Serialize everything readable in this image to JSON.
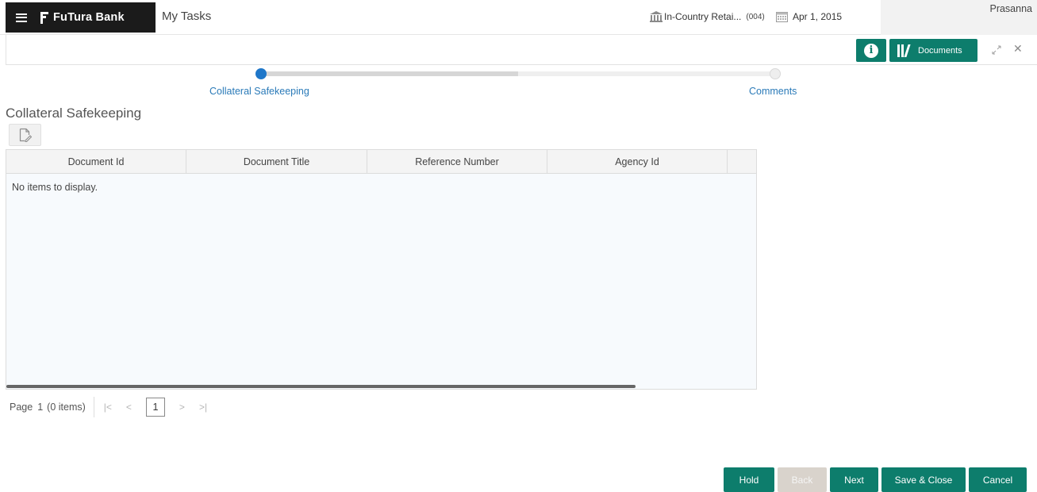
{
  "header": {
    "brand": "FuTura Bank",
    "app_title": "My Tasks",
    "branch": "In-Country Retai...",
    "branch_code": "(004)",
    "date": "Apr 1, 2015",
    "user": "Prasanna"
  },
  "toolbar": {
    "documents_label": "Documents",
    "info_glyph": "i"
  },
  "stepper": {
    "steps": [
      {
        "label": "Collateral Safekeeping",
        "active": true
      },
      {
        "label": "Comments",
        "active": false
      }
    ],
    "progress": 0.5
  },
  "section": {
    "title": "Collateral Safekeeping"
  },
  "grid": {
    "columns": [
      "Document Id",
      "Document Title",
      "Reference Number",
      "Agency Id"
    ],
    "empty_text": "No items to display."
  },
  "pager": {
    "page_label": "Page",
    "page": "1",
    "items": "(0 items)",
    "current_page": "1"
  },
  "footer": {
    "hold": "Hold",
    "back": "Back",
    "next": "Next",
    "save_close": "Save & Close",
    "cancel": "Cancel"
  },
  "colors": {
    "accent": "#0d7d6c",
    "step_active": "#1f77c9",
    "brand_bg": "#1b1b1b"
  }
}
